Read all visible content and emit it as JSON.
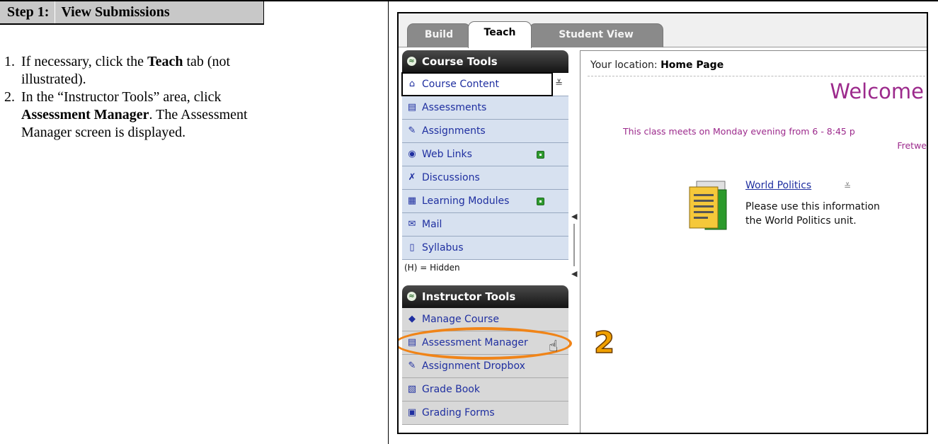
{
  "step": {
    "label": "Step 1:",
    "title": "View Submissions"
  },
  "instructions": [
    {
      "num": "1.",
      "parts": [
        {
          "t": "If necessary, click the "
        },
        {
          "t": "Teach",
          "b": true
        },
        {
          "t": " tab (not illustrated)."
        }
      ]
    },
    {
      "num": "2.",
      "parts": [
        {
          "t": "In the “Instructor Tools” area, click "
        },
        {
          "t": "Assessment Manager",
          "b": true
        },
        {
          "t": ". The Assessment Manager screen is displayed."
        }
      ]
    }
  ],
  "screenshot": {
    "tabs": [
      {
        "label": "Build",
        "active": false
      },
      {
        "label": "Teach",
        "active": true
      },
      {
        "label": "Student View",
        "active": false
      }
    ],
    "course_tools": {
      "title": "Course Tools",
      "items": [
        {
          "label": "Course Content",
          "icon": "home-icon",
          "glyph": "⌂",
          "selected": true,
          "chevron": "≚"
        },
        {
          "label": "Assessments",
          "icon": "assessments-icon",
          "glyph": "▤"
        },
        {
          "label": "Assignments",
          "icon": "assignments-icon",
          "glyph": "✎"
        },
        {
          "label": "Web Links",
          "icon": "globe-icon",
          "glyph": "◉",
          "badge": true
        },
        {
          "label": "Discussions",
          "icon": "pin-icon",
          "glyph": "✗"
        },
        {
          "label": "Learning Modules",
          "icon": "modules-icon",
          "glyph": "▦",
          "badge": true
        },
        {
          "label": "Mail",
          "icon": "mail-icon",
          "glyph": "✉"
        },
        {
          "label": "Syllabus",
          "icon": "syllabus-icon",
          "glyph": "▯"
        }
      ],
      "hidden_note": "(H) = Hidden"
    },
    "instructor_tools": {
      "title": "Instructor Tools",
      "items": [
        {
          "label": "Manage Course",
          "icon": "manage-course-icon",
          "glyph": "◆"
        },
        {
          "label": "Assessment Manager",
          "icon": "assessment-manager-icon",
          "glyph": "▤"
        },
        {
          "label": "Assignment Dropbox",
          "icon": "dropbox-icon",
          "glyph": "✎"
        },
        {
          "label": "Grade Book",
          "icon": "gradebook-icon",
          "glyph": "▧"
        },
        {
          "label": "Grading Forms",
          "icon": "grading-forms-icon",
          "glyph": "▣"
        }
      ]
    },
    "location_label": "Your location:",
    "location_value": "Home Page",
    "welcome": "Welcome",
    "meets_text": "This class meets on Monday evening from 6 - 8:45 p",
    "meets_text_2": "Fretwe",
    "content_item": {
      "link": "World Politics",
      "desc_line1": "Please use this information",
      "desc_line2": "the World Politics unit."
    },
    "callout_number": "2",
    "colors": {
      "accent_purple": "#9c2a8c",
      "callout_orange": "#f08418",
      "link_blue": "#1f2fa0"
    }
  }
}
